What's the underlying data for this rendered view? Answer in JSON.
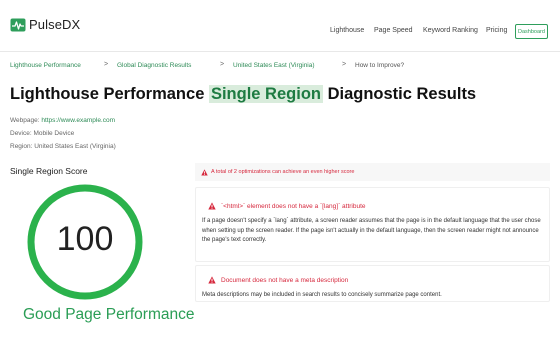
{
  "brand": {
    "name": "PulseDX",
    "accent": "#2e9e5b",
    "error_color": "#d6283d"
  },
  "nav": {
    "items": [
      "Lighthouse",
      "Page Speed",
      "Keyword Ranking",
      "Pricing"
    ],
    "dashboard_label": "Dashboard"
  },
  "breadcrumb": {
    "items": [
      "Lighthouse Performance",
      "Global Diagnostic Results",
      "United States East (Virginia)"
    ],
    "current": "How to Improve?",
    "separator": ">"
  },
  "page": {
    "title_pre": "Lighthouse Performance",
    "title_highlight": "Single Region",
    "title_post": "Diagnostic Results"
  },
  "details": {
    "webpage_label": "Webpage:",
    "webpage_url": "https://www.example.com",
    "device": "Device: Mobile Device",
    "region": "Region: United States East (Virginia)"
  },
  "score": {
    "label": "Single Region Score",
    "value": "100",
    "fraction": 1.0,
    "status": "Good Page Performance"
  },
  "optimizations": {
    "banner": "A total of 2 optimizations can achieve an even higher score",
    "items": [
      {
        "title": "`<html>` element does not have a `[lang]` attribute",
        "body": "If a page doesn't specify a `lang` attribute, a screen reader assumes that the page is in the default language that the user chose when setting up the screen reader. If the page isn't actually in the default language, then the screen reader might not announce the page's text correctly."
      },
      {
        "title": "Document does not have a meta description",
        "body": "Meta descriptions may be included in search results to concisely summarize page content."
      }
    ]
  }
}
